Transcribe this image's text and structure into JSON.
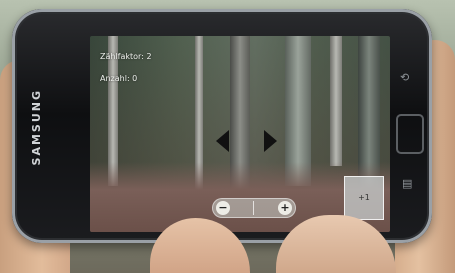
{
  "device": {
    "brand": "SAMSUNG"
  },
  "screen": {
    "counter_label": "Zählfaktor: 2",
    "count_label": "Anzahl: 0",
    "plus_one_label": "+1",
    "zoom_out_symbol": "−",
    "zoom_in_symbol": "+"
  },
  "icons": {
    "back_key": "back-arrow-icon",
    "menu_key": "menu-icon",
    "prev": "arrow-left-icon",
    "next": "arrow-right-icon"
  }
}
